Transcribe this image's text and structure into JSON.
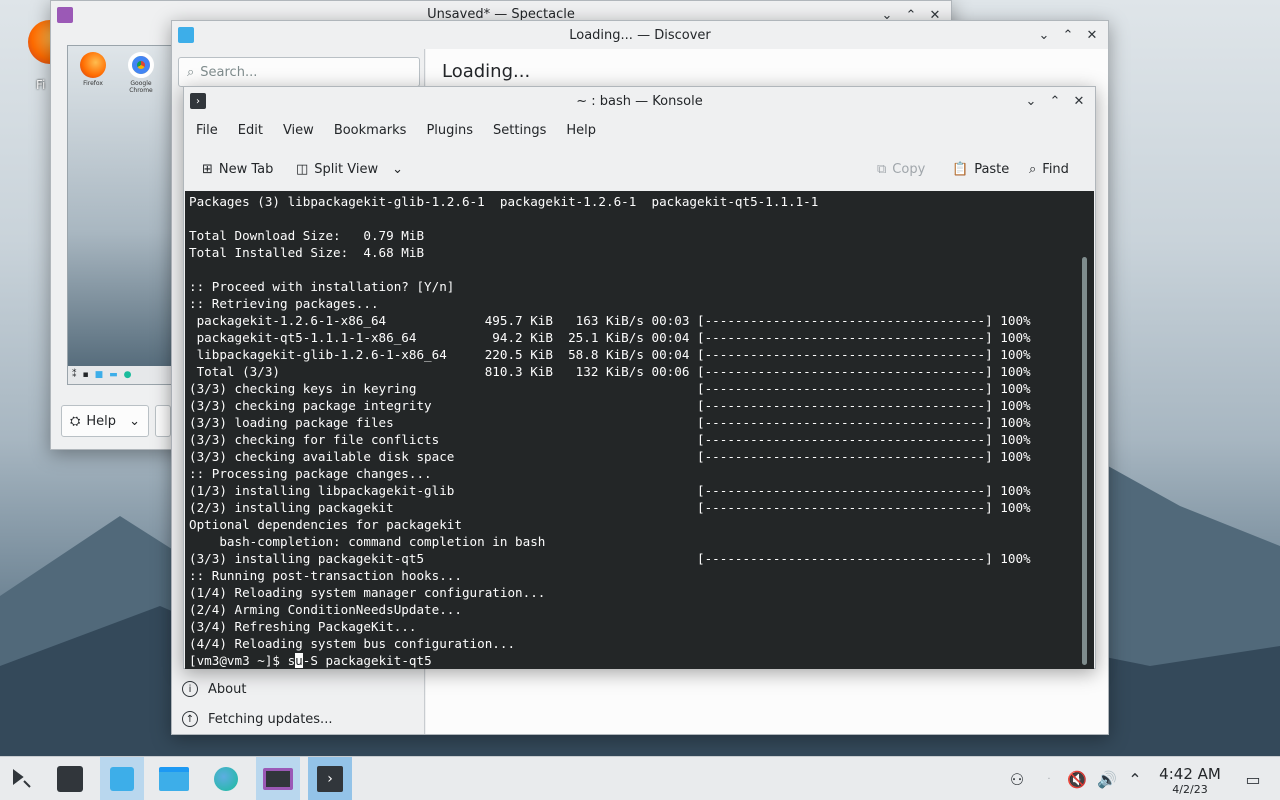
{
  "desktop": {
    "firefox_label": "Fi"
  },
  "spectacle": {
    "title": "Unsaved* — Spectacle",
    "preview_labels": [
      "Firefox",
      "Google Chrome"
    ],
    "help_label": "Help"
  },
  "discover": {
    "title": "Loading... — Discover",
    "search_placeholder": "Search...",
    "loading": "Loading...",
    "about": "About",
    "fetching": "Fetching updates..."
  },
  "konsole": {
    "title": "~ : bash — Konsole",
    "menu": [
      "File",
      "Edit",
      "View",
      "Bookmarks",
      "Plugins",
      "Settings",
      "Help"
    ],
    "toolbar": {
      "new_tab": "New Tab",
      "split_view": "Split View",
      "copy": "Copy",
      "paste": "Paste",
      "find": "Find"
    },
    "terminal": [
      "Packages (3) libpackagekit-glib-1.2.6-1  packagekit-1.2.6-1  packagekit-qt5-1.1.1-1",
      "",
      "Total Download Size:   0.79 MiB",
      "Total Installed Size:  4.68 MiB",
      "",
      ":: Proceed with installation? [Y/n]",
      ":: Retrieving packages...",
      " packagekit-1.2.6-1-x86_64             495.7 KiB   163 KiB/s 00:03 [-------------------------------------] 100%",
      " packagekit-qt5-1.1.1-1-x86_64          94.2 KiB  25.1 KiB/s 00:04 [-------------------------------------] 100%",
      " libpackagekit-glib-1.2.6-1-x86_64     220.5 KiB  58.8 KiB/s 00:04 [-------------------------------------] 100%",
      " Total (3/3)                           810.3 KiB   132 KiB/s 00:06 [-------------------------------------] 100%",
      "(3/3) checking keys in keyring                                     [-------------------------------------] 100%",
      "(3/3) checking package integrity                                   [-------------------------------------] 100%",
      "(3/3) loading package files                                        [-------------------------------------] 100%",
      "(3/3) checking for file conflicts                                  [-------------------------------------] 100%",
      "(3/3) checking available disk space                                [-------------------------------------] 100%",
      ":: Processing package changes...",
      "(1/3) installing libpackagekit-glib                                [-------------------------------------] 100%",
      "(2/3) installing packagekit                                        [-------------------------------------] 100%",
      "Optional dependencies for packagekit",
      "    bash-completion: command completion in bash",
      "(3/3) installing packagekit-qt5                                    [-------------------------------------] 100%",
      ":: Running post-transaction hooks...",
      "(1/4) Reloading system manager configuration...",
      "(2/4) Arming ConditionNeedsUpdate...",
      "(3/4) Refreshing PackageKit...",
      "(4/4) Reloading system bus configuration..."
    ],
    "prompt": "[vm3@vm3 ~]$ s",
    "cursor_char": "u",
    "prompt_rest": "-S packagekit-qt5"
  },
  "taskbar": {
    "time": "4:42 AM",
    "date": "4/2/23"
  }
}
